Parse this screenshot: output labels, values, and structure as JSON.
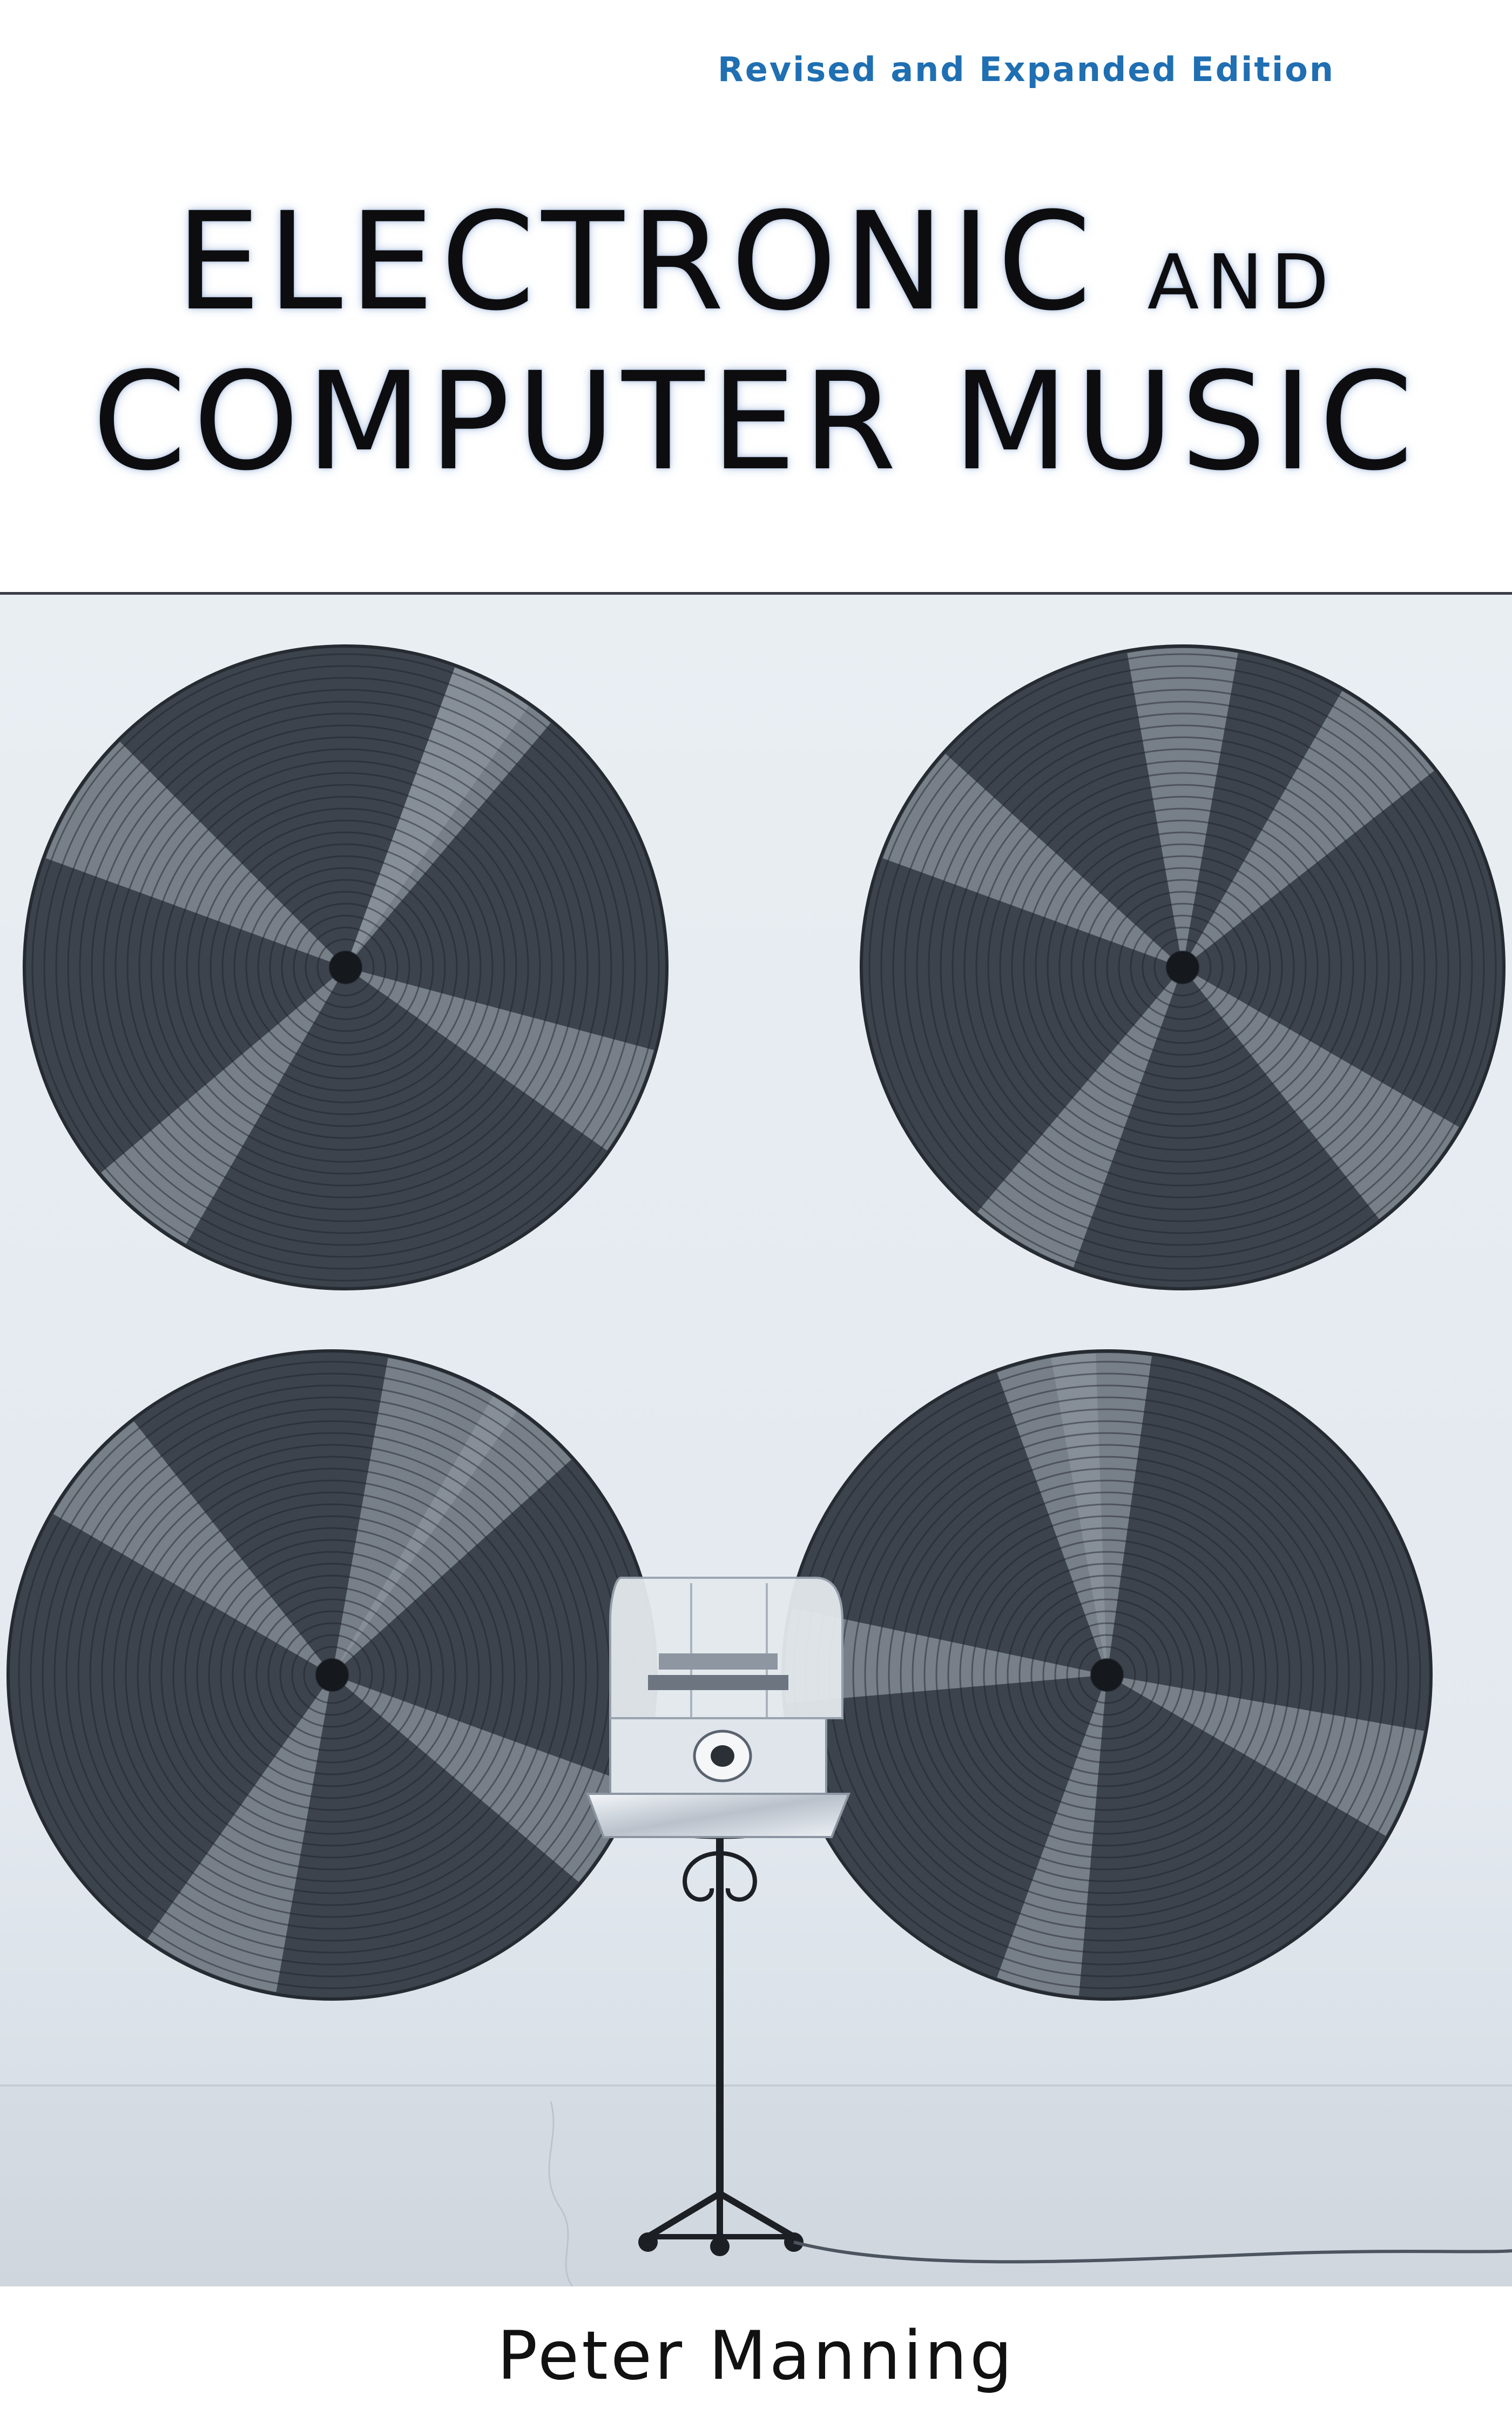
{
  "cover": {
    "edition": "Revised and Expanded Edition",
    "title_line1_a": "ELECTRONIC",
    "title_line1_b": "AND",
    "title_line2": "COMPUTER MUSIC",
    "author": "Peter Manning"
  },
  "colors": {
    "edition_text": "#1f6fb2",
    "title_text": "#0d0d0f",
    "wall": "#e6ebf0",
    "floor": "#d5dbe2",
    "disc": "#3c434d"
  }
}
